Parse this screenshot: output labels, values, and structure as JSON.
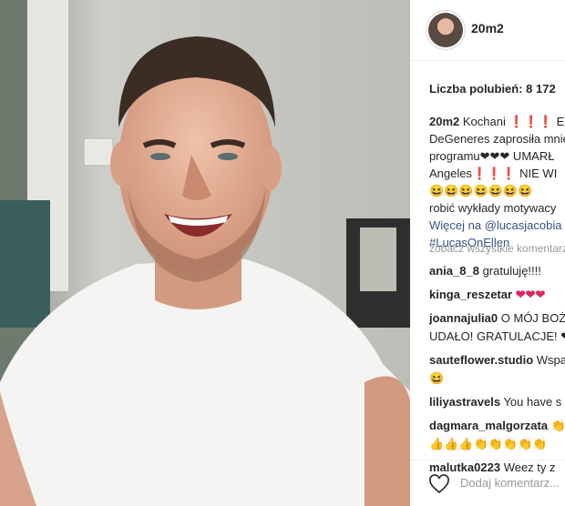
{
  "post": {
    "username": "20m2",
    "likes": "Liczba polubień: 8 172",
    "caption_lines": [
      "Kochani ❗❗❗ Ellen",
      "DeGeneres zaprosiła mnie",
      "programu❤❤❤ UMARŁ",
      "Angeles❗❗❗ NIE WI",
      "😆😆😆😆😆😆😆",
      "robić wykłady motywacy",
      "Więcej na @lucasjacobia",
      "#LucasOnEllen"
    ],
    "view_all": "zobacz wszystkie komentarze",
    "comments": [
      {
        "user": "ania_8_8",
        "text": "gratuluję!!!!"
      },
      {
        "user": "kinga_reszetar",
        "text": "❤❤❤"
      },
      {
        "user": "joannajulia0",
        "text": "O MÓJ BOŻE",
        "text2": "UDAŁO! GRATULACJE! ❤"
      },
      {
        "user": "sauteflower.studio",
        "text": "Wspaniale",
        "text2": "😆"
      },
      {
        "user": "liliyastravels",
        "text": "You have s"
      },
      {
        "user": "dagmara_malgorzata",
        "text": "👏",
        "text2": "👍👍👍👏👏👏👏👏"
      },
      {
        "user": "malutka0223",
        "text": "Weez ty z"
      }
    ],
    "add_comment_placeholder": "Dodaj komentarz..."
  },
  "colors": {
    "accent": "#385185",
    "text": "#262626",
    "muted": "#999999",
    "heart": "#e0245e"
  },
  "icons": {
    "like": "heart-outline-icon"
  }
}
